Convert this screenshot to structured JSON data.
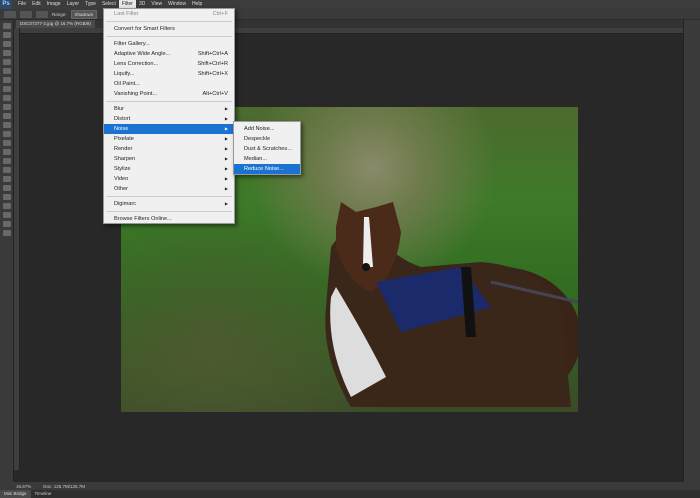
{
  "menubar": {
    "logo": "Ps",
    "items": [
      "File",
      "Edit",
      "Image",
      "Layer",
      "Type",
      "Select",
      "Filter",
      "3D",
      "View",
      "Window",
      "Help"
    ],
    "active": "Filter"
  },
  "options": {
    "range_label": "Range:",
    "range_value": "Shadows"
  },
  "document": {
    "tab_title": "DSC07377-2.jpg @ 16.7% (RGB/8)"
  },
  "filter_menu": {
    "last_filter": {
      "label": "Last Filter",
      "shortcut": "Ctrl+F"
    },
    "convert": "Convert for Smart Filters",
    "group1": [
      {
        "label": "Filter Gallery...",
        "shortcut": ""
      },
      {
        "label": "Adaptive Wide Angle...",
        "shortcut": "Shift+Ctrl+A"
      },
      {
        "label": "Lens Correction...",
        "shortcut": "Shift+Ctrl+R"
      },
      {
        "label": "Liquify...",
        "shortcut": "Shift+Ctrl+X"
      },
      {
        "label": "Oil Paint...",
        "shortcut": ""
      },
      {
        "label": "Vanishing Point...",
        "shortcut": "Alt+Ctrl+V"
      }
    ],
    "group2": [
      "Blur",
      "Distort",
      "Noise",
      "Pixelate",
      "Render",
      "Sharpen",
      "Stylize",
      "Video",
      "Other"
    ],
    "highlighted": "Noise",
    "digimarc": "Digimarc",
    "browse": "Browse Filters Online..."
  },
  "noise_submenu": {
    "items": [
      "Add Noise...",
      "Despeckle",
      "Dust & Scratches...",
      "Median...",
      "Reduce Noise..."
    ],
    "highlighted": "Reduce Noise..."
  },
  "status": {
    "zoom": "16.67%",
    "doc": "Doc: 125.7M/125.7M"
  },
  "bottom_tabs": [
    "Mini Bridge",
    "Timeline"
  ],
  "colors": {
    "accent": "#1a73d0",
    "canvas": "#282828"
  }
}
